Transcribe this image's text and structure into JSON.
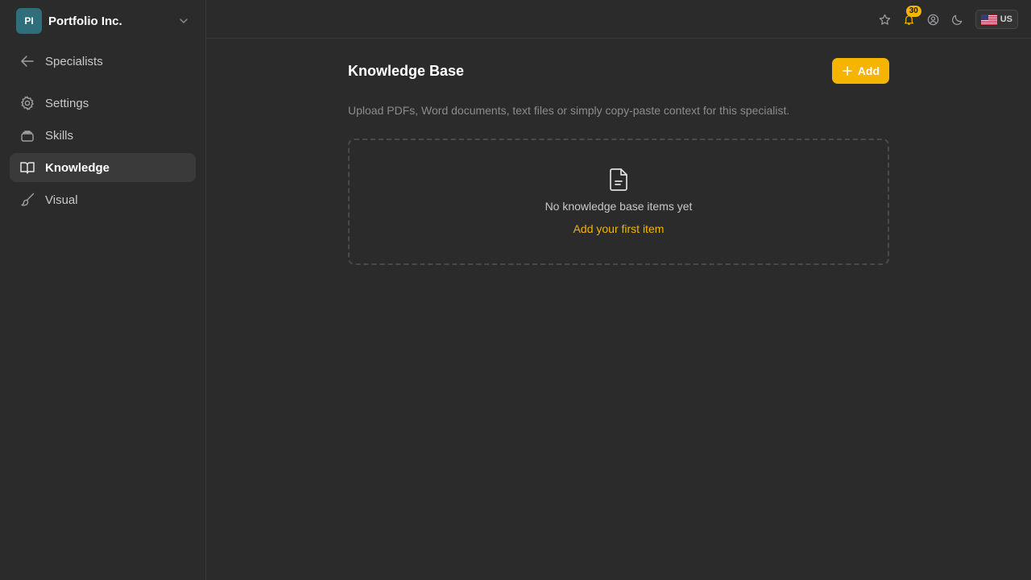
{
  "org": {
    "initials": "PI",
    "name": "Portfolio Inc."
  },
  "sidebar": {
    "back_label": "Specialists",
    "items": [
      {
        "label": "Settings",
        "icon": "gear-icon"
      },
      {
        "label": "Skills",
        "icon": "layers-icon"
      },
      {
        "label": "Knowledge",
        "icon": "book-icon",
        "active": true
      },
      {
        "label": "Visual",
        "icon": "brush-icon"
      }
    ]
  },
  "topbar": {
    "notifications_count": "30",
    "language": "US"
  },
  "main": {
    "title": "Knowledge Base",
    "add_label": "Add",
    "description": "Upload PDFs, Word documents, text files or simply copy-paste context for this specialist.",
    "empty_text": "No knowledge base items yet",
    "first_item_link": "Add your first item"
  },
  "colors": {
    "accent": "#f5b400",
    "background": "#2b2b2b",
    "avatar": "#2f6f7c"
  }
}
